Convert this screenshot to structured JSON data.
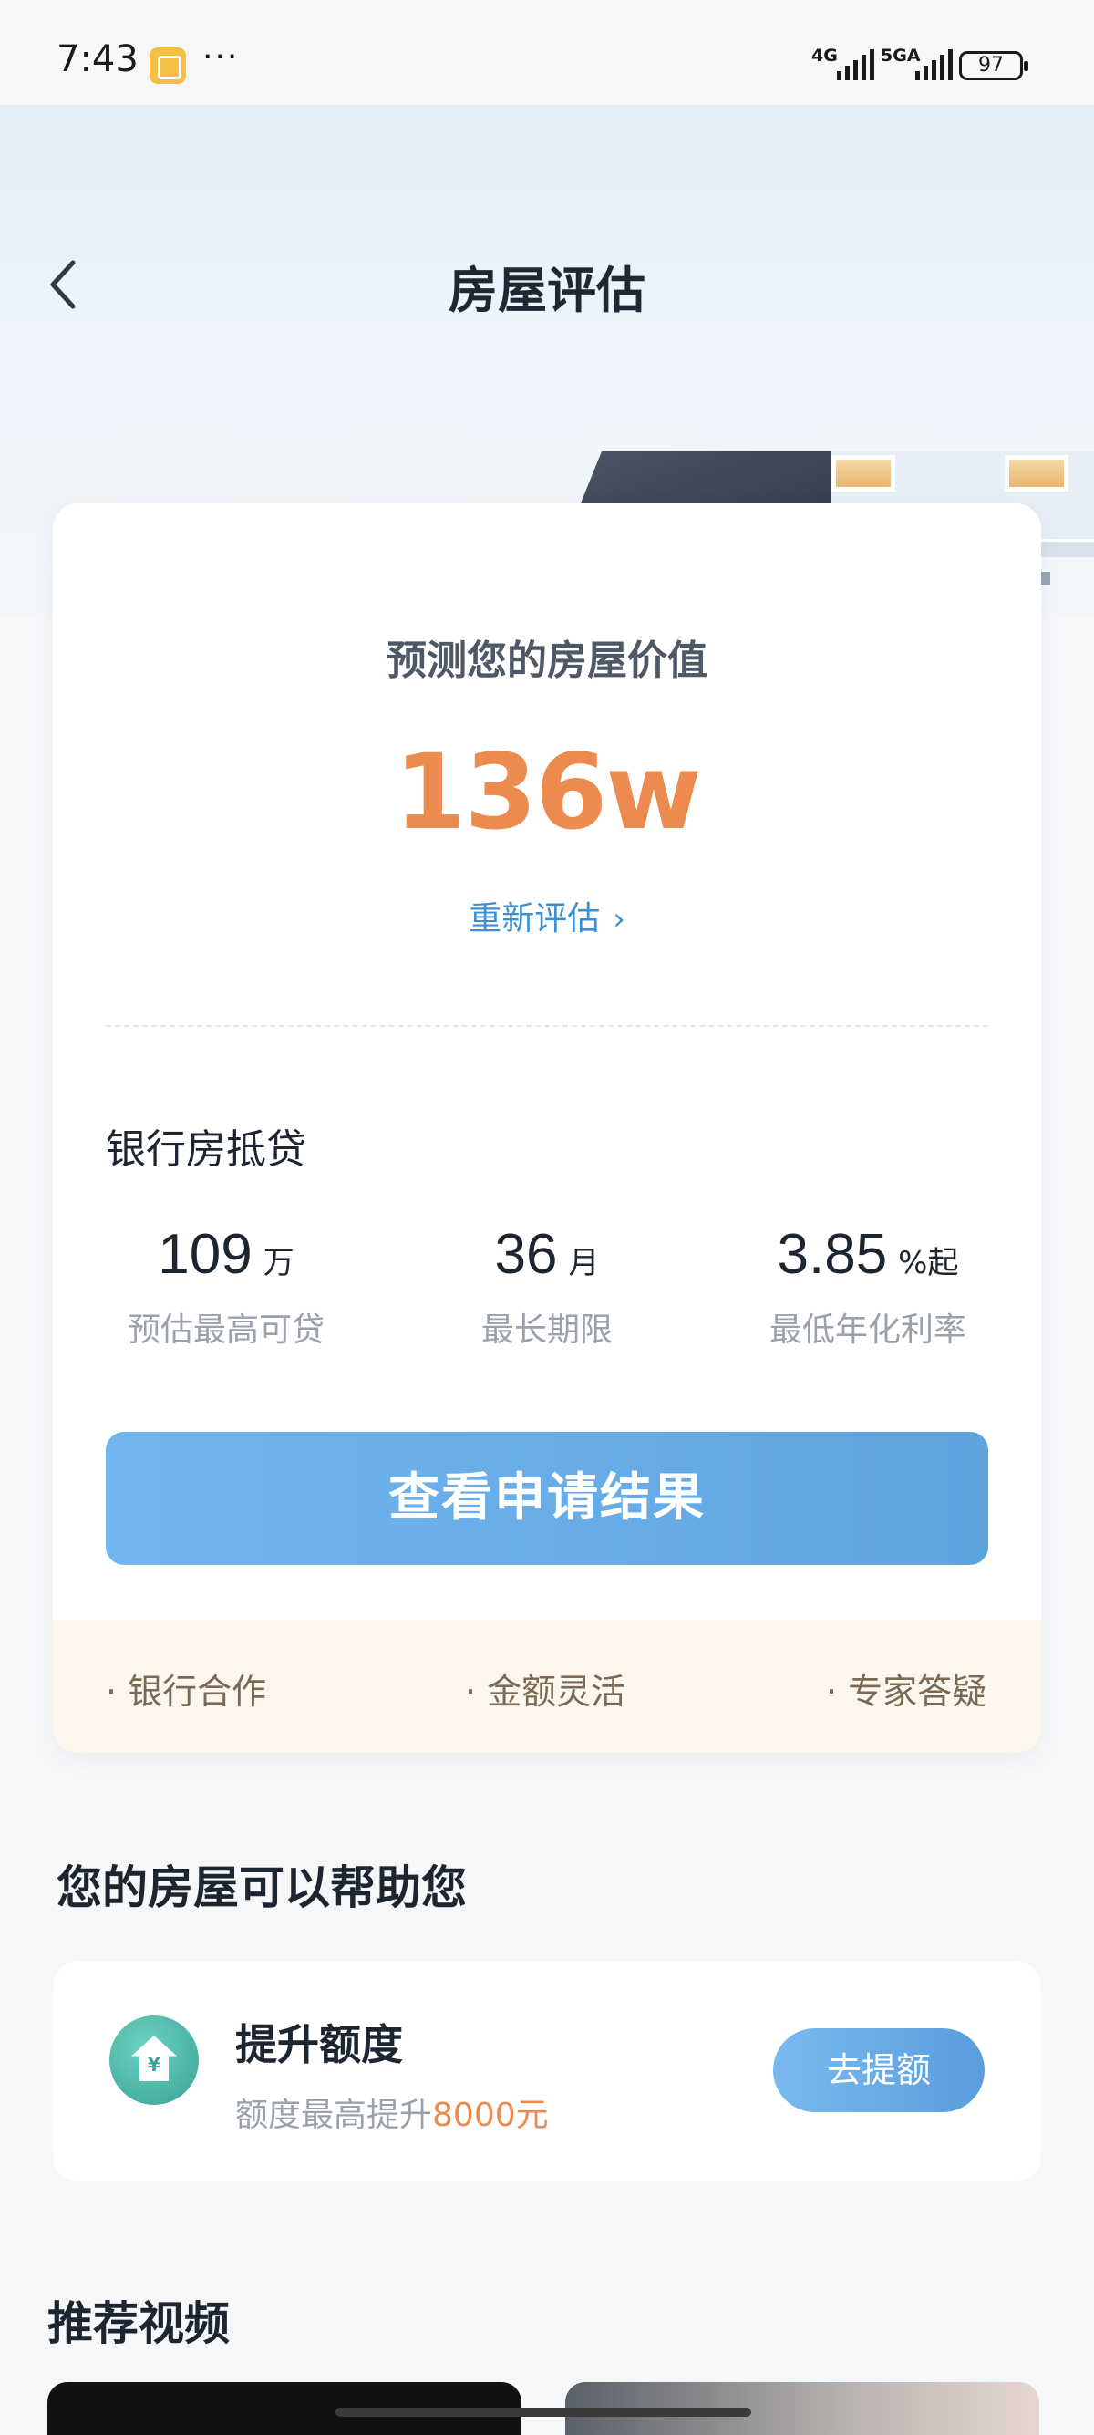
{
  "status_bar": {
    "time": "7:43",
    "more": "···",
    "network_1": "4G",
    "network_2": "5GA",
    "battery": "97",
    "app_icon": "notes-app-icon"
  },
  "header": {
    "title": "房屋评估",
    "back_icon": "chevron-left-icon"
  },
  "valuation": {
    "label": "预测您的房屋价值",
    "value": "136w",
    "reassess_label": "重新评估",
    "reassess_icon": "chevron-right-icon"
  },
  "loan": {
    "title": "银行房抵贷",
    "stats": [
      {
        "value": "109",
        "unit": "万",
        "label": "预估最高可贷"
      },
      {
        "value": "36",
        "unit": "月",
        "label": "最长期限"
      },
      {
        "value": "3.85",
        "unit": "%起",
        "label": "最低年化利率"
      }
    ],
    "apply_label": "查看申请结果"
  },
  "features": [
    "· 银行合作",
    "· 金额灵活",
    "· 专家答疑"
  ],
  "help": {
    "title": "您的房屋可以帮助您",
    "item": {
      "icon": "house-yen-icon",
      "icon_glyph": "¥",
      "name": "提升额度",
      "sub_prefix": "额度最高提升",
      "sub_highlight": "8000元",
      "button": "去提额"
    }
  },
  "videos": {
    "title": "推荐视频"
  },
  "colors": {
    "accent_orange": "#ec8a50",
    "accent_blue": "#5ea4df",
    "link_blue": "#3d8fcf"
  }
}
